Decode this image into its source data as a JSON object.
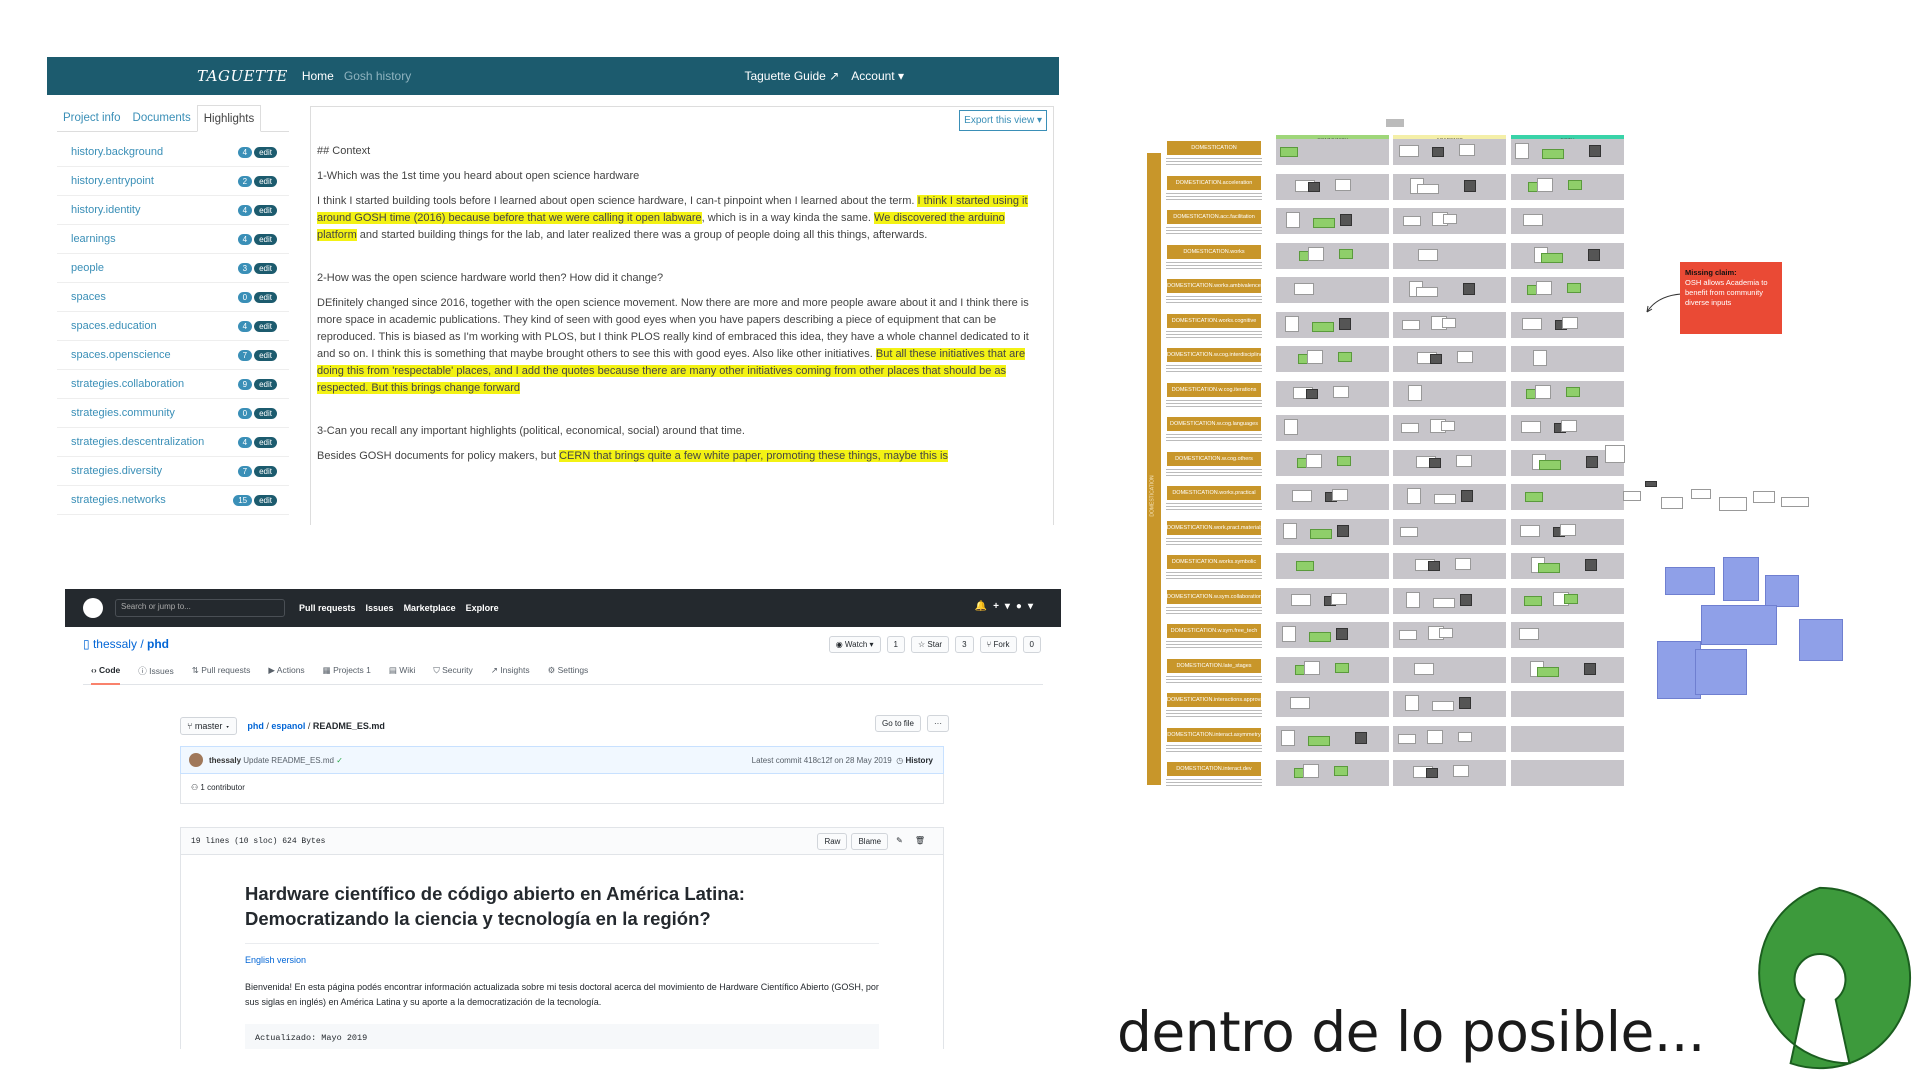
{
  "taguette": {
    "brand": "TAGUETTE",
    "nav": {
      "home": "Home",
      "project": "Gosh history",
      "guide": "Taguette Guide",
      "account": "Account"
    },
    "tabs": [
      "Project info",
      "Documents",
      "Highlights"
    ],
    "highlights": [
      {
        "name": "history.background",
        "count": "4"
      },
      {
        "name": "history.entrypoint",
        "count": "2"
      },
      {
        "name": "history.identity",
        "count": "4"
      },
      {
        "name": "learnings",
        "count": "4"
      },
      {
        "name": "people",
        "count": "3"
      },
      {
        "name": "spaces",
        "count": "0"
      },
      {
        "name": "spaces.education",
        "count": "4"
      },
      {
        "name": "spaces.openscience",
        "count": "7"
      },
      {
        "name": "strategies.collaboration",
        "count": "9"
      },
      {
        "name": "strategies.community",
        "count": "0"
      },
      {
        "name": "strategies.descentralization",
        "count": "4"
      },
      {
        "name": "strategies.diversity",
        "count": "7"
      },
      {
        "name": "strategies.networks",
        "count": "15"
      }
    ],
    "edit_label": "edit",
    "export_label": "Export this view",
    "doc": {
      "heading": "## Context",
      "q1": "1-Which was the 1st time you heard about open science hardware",
      "p1a": "I think I started building tools before I learned about open science hardware, I can-t pinpoint when I learned about the term. ",
      "p1b": "I think I started using it around GOSH time (2016) because before that we were calling it open labware",
      "p1c": ", which is in a way kinda the same. ",
      "p1d": "We discovered the arduino platform",
      "p1e": " and started building things for the lab, and later realized there was a group of people doing all this things, afterwards.",
      "q2": "2-How was the open science hardware world then? How did it change?",
      "p2a": "DEfinitely changed since 2016, together with the open science movement. Now there are more and more people aware about it and I think there is more space in academic publications. They kind of seen with good eyes when you have papers describing a piece of equipment that can be reproduced. This is biased as I'm working with PLOS, but I think PLOS really kind of embraced this idea, they have a whole channel dedicated to it and so on. I think this is something that maybe brought others to see this with good eyes. Also like other initiatives. ",
      "p2b": "But all these initiatives that are doing this from 'respectable' places, and I add the quotes because there are many other initiatives coming from other places that should be as respected. But this brings change forward",
      "q3": "3-Can you recall any important highlights (political, economical, social) around that time.",
      "p3a": "Besides GOSH documents for policy makers, but ",
      "p3b": "CERN that brings quite a few white paper, promoting these things, maybe this is"
    }
  },
  "github": {
    "search_placeholder": "Search or jump to...",
    "top_links": [
      "Pull requests",
      "Issues",
      "Marketplace",
      "Explore"
    ],
    "owner": "thessaly",
    "repo": "phd",
    "actions": {
      "watch": "Watch",
      "watch_count": "1",
      "star": "Star",
      "star_count": "3",
      "fork": "Fork",
      "fork_count": "0"
    },
    "tabs": [
      "Code",
      "Issues",
      "Pull requests",
      "Actions",
      "Projects 1",
      "Wiki",
      "Security",
      "Insights",
      "Settings"
    ],
    "branch": "master",
    "path": {
      "root": "phd",
      "folder": "espanol",
      "file": "README_ES.md"
    },
    "go_to_file": "Go to file",
    "more": "···",
    "commit": {
      "author": "thessaly",
      "message": "Update README_ES.md",
      "latest": "Latest commit 418c12f on 28 May 2019",
      "history": "History"
    },
    "contributors": "1 contributor",
    "file_info": "19 lines (10 sloc)   624 Bytes",
    "raw": "Raw",
    "blame": "Blame",
    "readme": {
      "title": "Hardware científico de código abierto en América Latina: Democratizando la ciencia y tecnología en la región?",
      "english_link": "English version",
      "body": "Bienvenida! En esta página podés encontrar información actualizada sobre mi tesis doctoral acerca del movimiento de Hardware Científico Abierto (GOSH, por sus siglas en inglés) en América Latina y su aporte a la democratización de la tecnología.",
      "code": "Actualizado: Mayo 2019"
    }
  },
  "board": {
    "columns": [
      "COMMUNITY",
      "ACADEMIC",
      "BOTH"
    ],
    "column_colors": [
      "#9fd67a",
      "#f4efa8",
      "#39d3a8"
    ],
    "side_label": "DOMESTICATION",
    "rows": [
      "DOMESTICATION",
      "DOMESTICATION.acceleration",
      "DOMESTICATION.acc.facilitation",
      "DOMESTICATION.works",
      "DOMESTICATION.works.ambivalence",
      "DOMESTICATION.works.cognitive",
      "DOMESTICATION.w.cog.interdiscipline",
      "DOMESTICATION.w.cog.iterations",
      "DOMESTICATION.w.cog.languages",
      "DOMESTICATION.w.cog.others",
      "DOMESTICATION.works.practical",
      "DOMESTICATION.work.pract.materials",
      "DOMESTICATION.works.symbolic",
      "DOMESTICATION.w.sym.collaboration",
      "DOMESTICATION.w.sym.free_tech",
      "DOMESTICATION.late_stages",
      "DOMESTICATION.interactions.approval",
      "DOMESTICATION.interact.asymmetry",
      "DOMESTICATION.interact.dev"
    ],
    "missing_claim": {
      "title": "Missing claim:",
      "text": "OSH allows Academia to benefit from community diverse inputs"
    }
  },
  "caption": "dentro de lo posible...",
  "logo": {
    "icon": "open-source-hardware-logo",
    "color": "#3d9a3c"
  }
}
